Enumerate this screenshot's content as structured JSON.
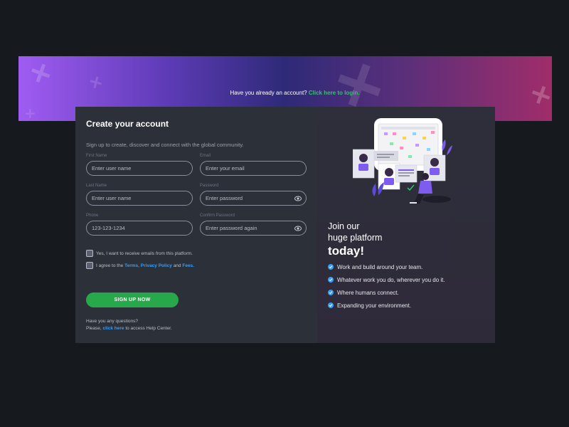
{
  "banner": {
    "question": "Have you already an account?",
    "login_link": "Click here to login."
  },
  "form": {
    "title": "Create your account",
    "subtitle": "Sign up to create, discover and connect with the global community.",
    "fields": {
      "first_name": {
        "label": "First Name",
        "placeholder": "Enter user name"
      },
      "email": {
        "label": "Email",
        "placeholder": "Enter your email"
      },
      "last_name": {
        "label": "Last Name",
        "placeholder": "Enter user name"
      },
      "password": {
        "label": "Password",
        "placeholder": "Enter password"
      },
      "phone": {
        "label": "Phone",
        "placeholder": "123-123-1234"
      },
      "confirm_password": {
        "label": "Confirm Password",
        "placeholder": "Enter password again"
      }
    },
    "checkbox_emails": "Yes, I want to receive emails from this platform.",
    "checkbox_agree_prefix": "I agree to the",
    "terms_link": "Terms",
    "privacy_link": "Privacy Policy",
    "and_text": "and",
    "fees_link": "Fees.",
    "signup_button": "SIGN UP NOW",
    "help_line1": "Have you any questions?",
    "help_prefix": "Please,",
    "help_link": "click here",
    "help_suffix": "to access Help Center."
  },
  "info": {
    "line1": "Join our",
    "line2": "huge platform",
    "line3": "today!",
    "features": [
      "Work and build around your team.",
      "Whatever work you do, wherever you do it.",
      "Where humans connect.",
      "Expanding your environment."
    ]
  },
  "colors": {
    "accent_green": "#27a84a",
    "link_blue": "#2f9fff",
    "background": "#16191e"
  }
}
